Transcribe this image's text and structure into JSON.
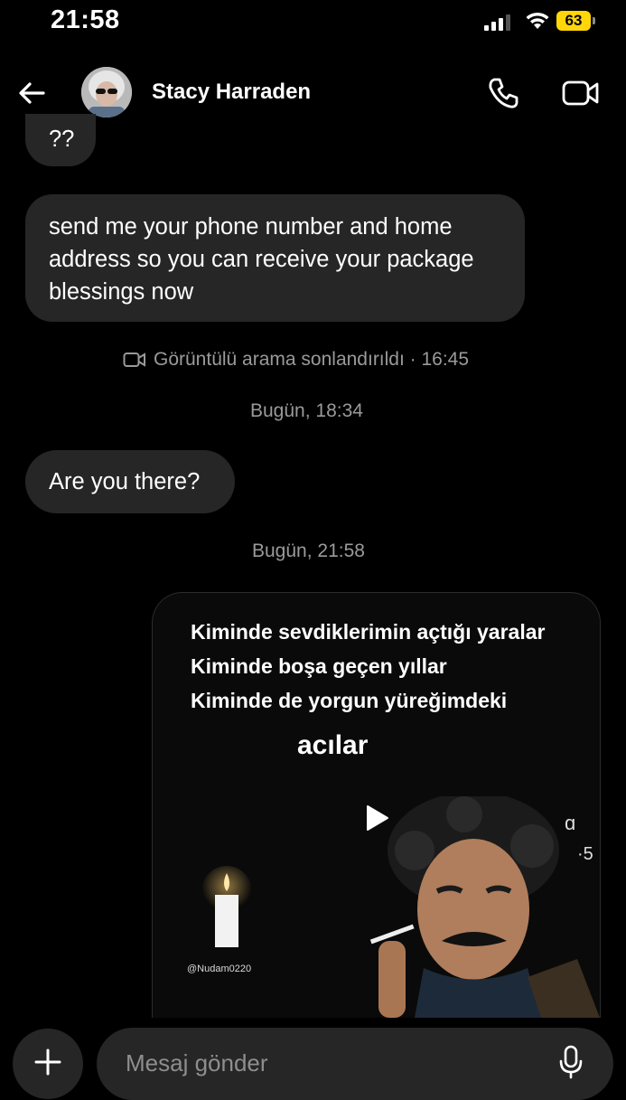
{
  "status_bar": {
    "time": "21:58",
    "battery": "63"
  },
  "header": {
    "contact_name": "Stacy Harraden"
  },
  "messages": [
    {
      "from": "them",
      "text": "??"
    },
    {
      "from": "them",
      "text": "send me your phone number and home address so you can receive your package blessings now"
    },
    {
      "from": "them",
      "text": "Are you there?"
    }
  ],
  "system": {
    "call_ended": "Görüntülü arama sonlandırıldı · 16:45",
    "timestamp_1": "Bugün, 18:34",
    "timestamp_2": "Bugün, 21:58"
  },
  "media": {
    "line1": "Kiminde sevdiklerimin açtığı yaralar",
    "line2": "Kiminde boşa geçen yıllar",
    "line3": "Kiminde de  yorgun yüreğimdeki",
    "line4": "acılar",
    "watermark": "@Nudam0220",
    "side_text_1": "ɑ",
    "side_text_2": "·5"
  },
  "composer": {
    "placeholder": "Mesaj gönder"
  },
  "icons": [
    "back-arrow-icon",
    "phone-icon",
    "video-camera-icon",
    "video-call-small-icon",
    "play-icon",
    "plus-icon",
    "microphone-icon"
  ],
  "colors": {
    "background": "#000000",
    "bubble": "#262626",
    "muted_text": "#9a9a9a",
    "battery": "#ffd60a"
  }
}
